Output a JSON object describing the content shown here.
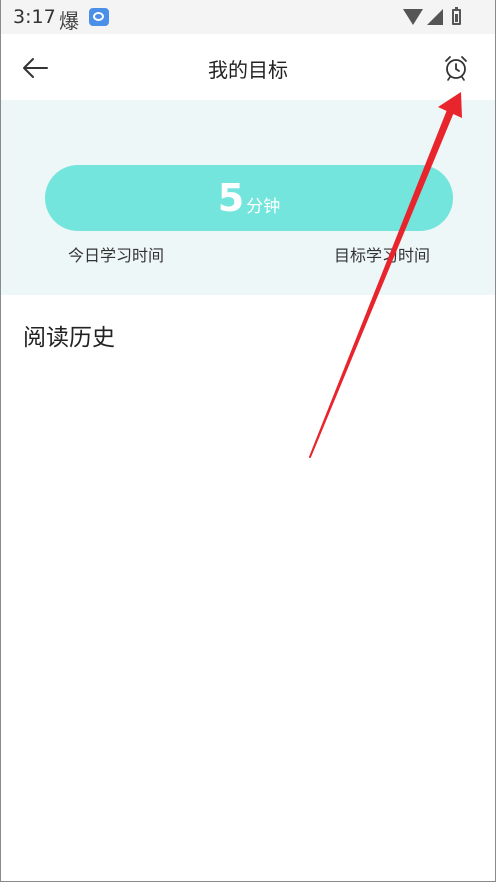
{
  "status_bar": {
    "time": "3:17",
    "notification_glyph": "爆",
    "app_icon": "app-notification-icon",
    "wifi_icon": "wifi-icon",
    "signal_icon": "signal-icon",
    "battery_icon": "battery-icon"
  },
  "header": {
    "title": "我的目标",
    "back_icon": "arrow-left-icon",
    "alarm_icon": "alarm-clock-icon"
  },
  "goal": {
    "value": "5",
    "unit": "分钟",
    "today_label": "今日学习时间",
    "target_label": "目标学习时间"
  },
  "history": {
    "title": "阅读历史"
  },
  "colors": {
    "accent": "#74e5dc",
    "panel_background": "#eef7f7",
    "annotation_arrow": "#e8242c"
  }
}
